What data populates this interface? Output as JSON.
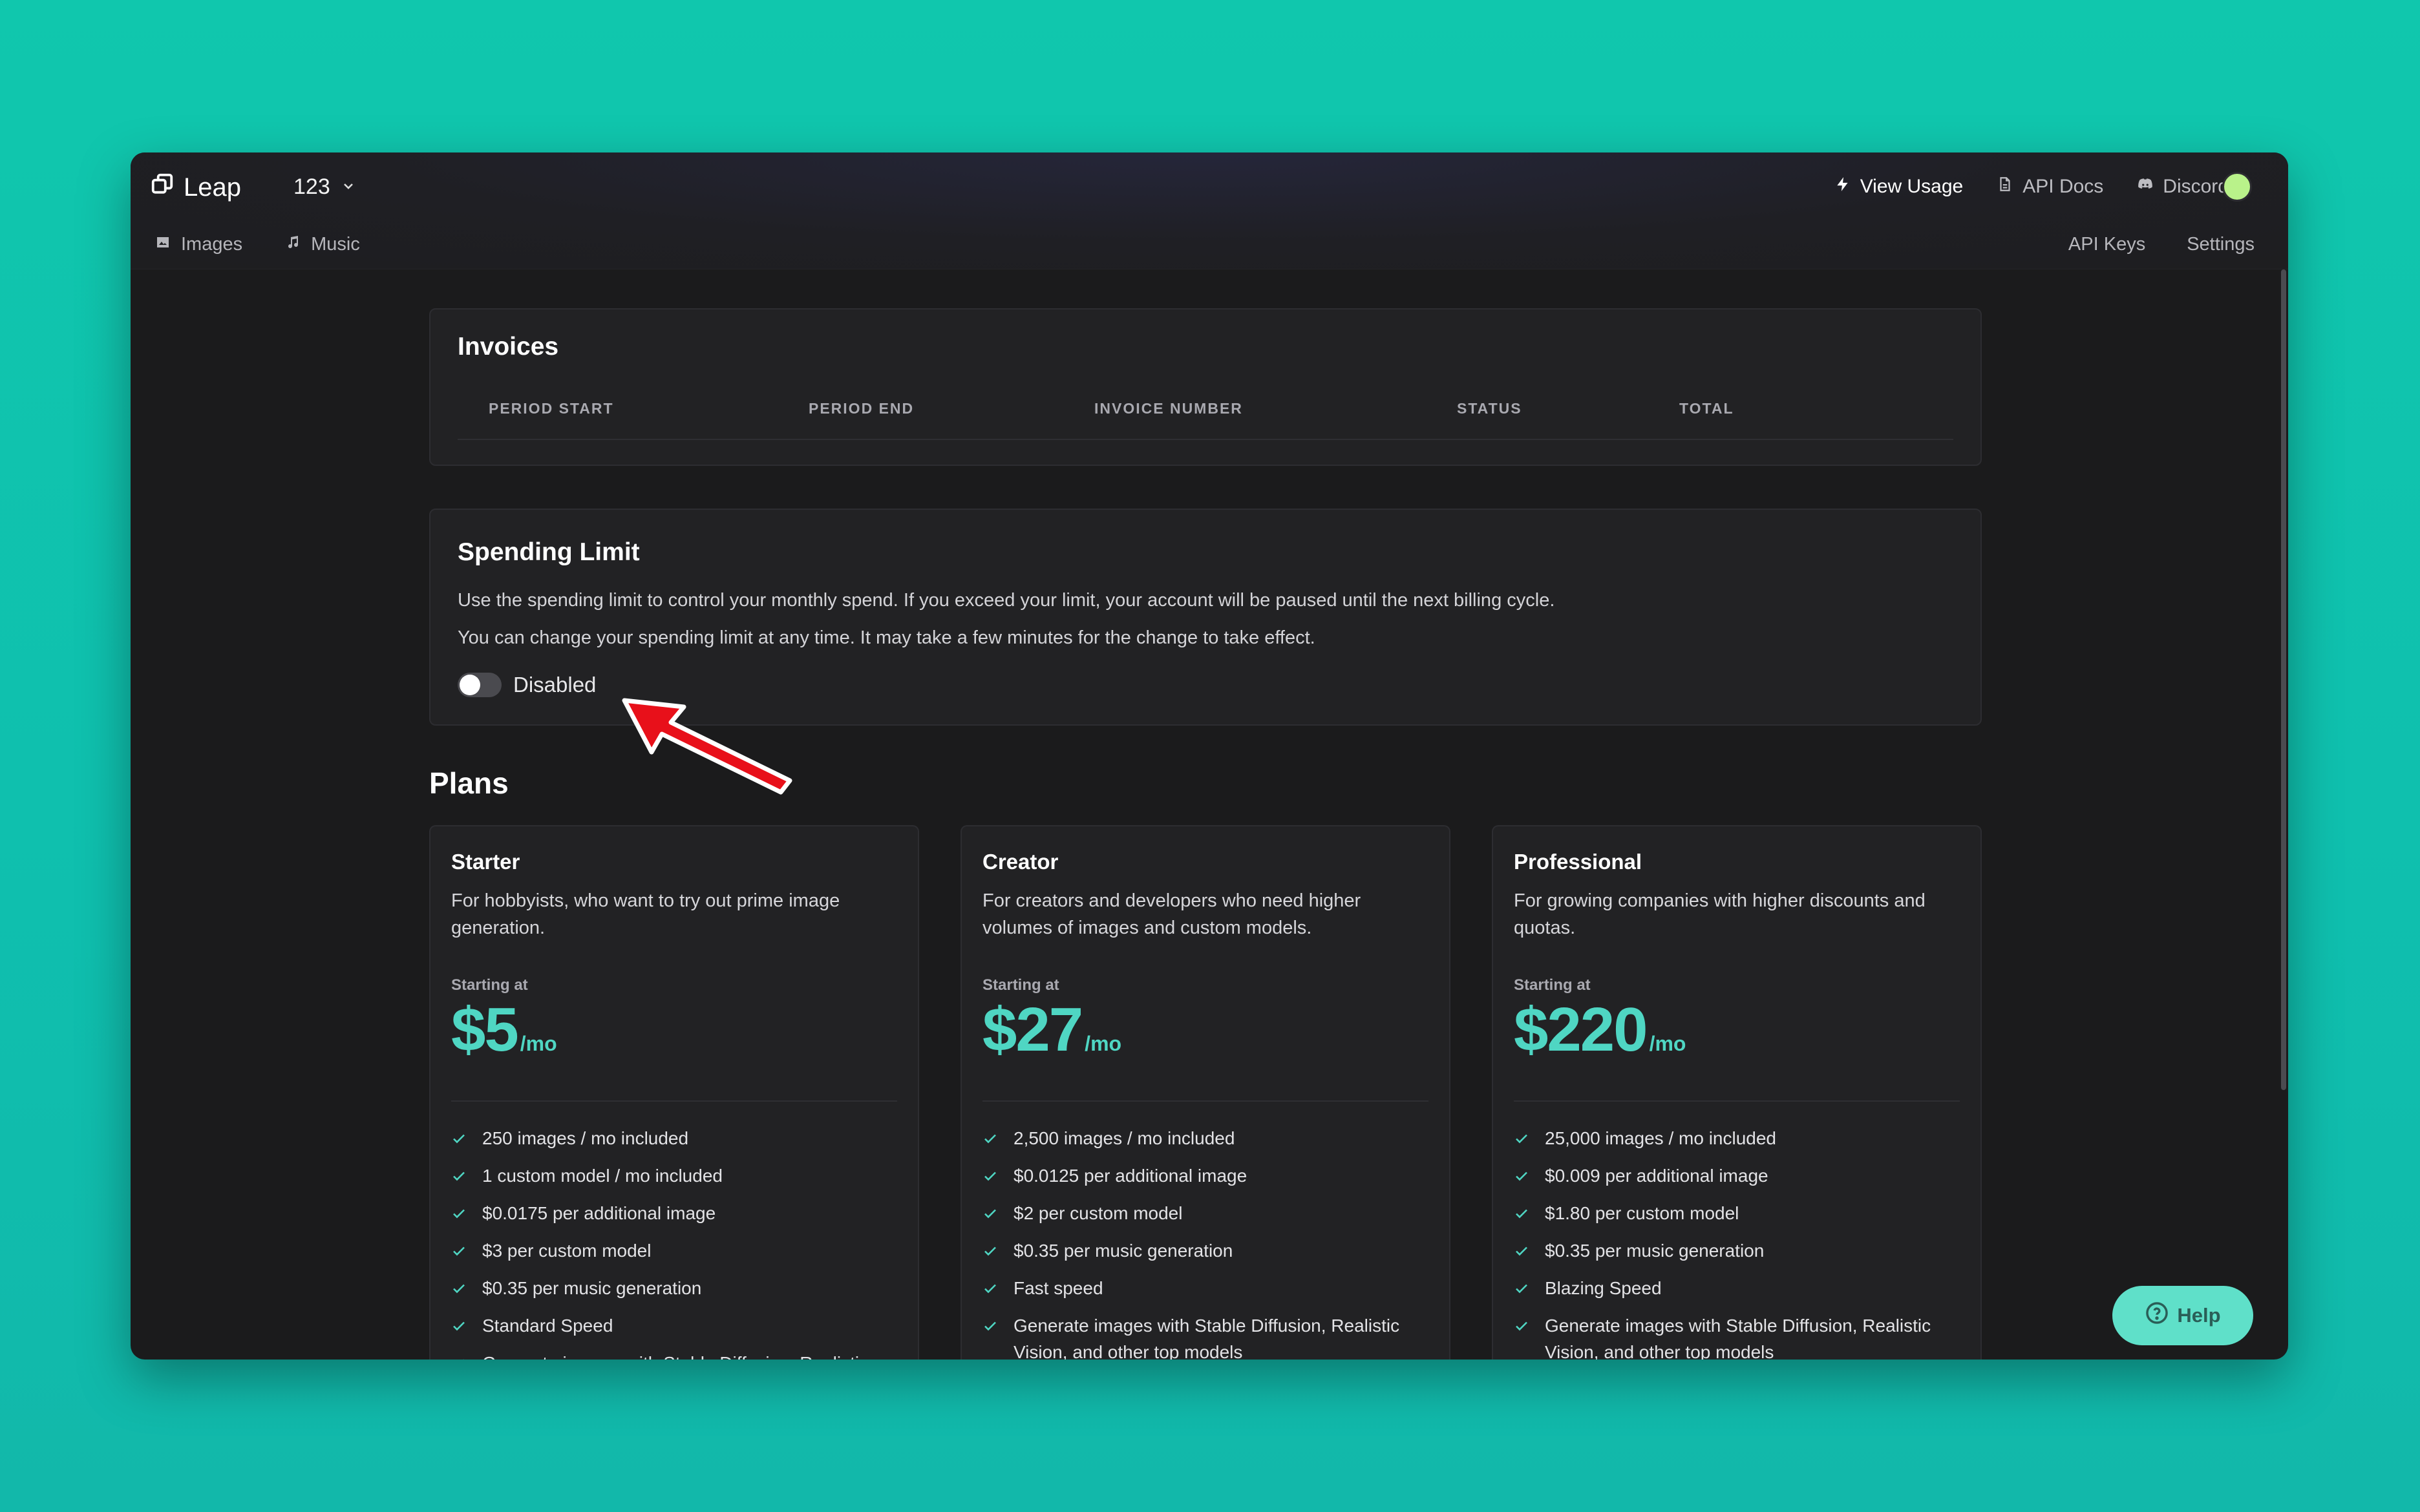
{
  "app": {
    "name": "Leap",
    "project": "123"
  },
  "header": {
    "view_usage": "View Usage",
    "api_docs": "API Docs",
    "discord": "Discord"
  },
  "subnav": {
    "images": "Images",
    "music": "Music",
    "api_keys": "API Keys",
    "settings": "Settings"
  },
  "invoices": {
    "title": "Invoices",
    "columns": [
      "PERIOD START",
      "PERIOD END",
      "INVOICE NUMBER",
      "STATUS",
      "TOTAL"
    ]
  },
  "spending": {
    "title": "Spending Limit",
    "line1": "Use the spending limit to control your monthly spend. If you exceed your limit, your account will be paused until the next billing cycle.",
    "line2": "You can change your spending limit at any time. It may take a few minutes for the change to take effect.",
    "toggle_label": "Disabled",
    "enabled": false
  },
  "plans": {
    "title": "Plans",
    "starting_label": "Starting at",
    "per": "/mo",
    "items": [
      {
        "name": "Starter",
        "desc": "For hobbyists, who want to try out prime image generation.",
        "price": "$5",
        "features": [
          "250 images / mo included",
          "1 custom model / mo included",
          "$0.0175 per additional image",
          "$3 per custom model",
          "$0.35 per music generation",
          "Standard Speed",
          "Generate images with Stable Diffusion, Realistic"
        ]
      },
      {
        "name": "Creator",
        "desc": "For creators and developers who need higher volumes of images and custom models.",
        "price": "$27",
        "features": [
          "2,500 images / mo included",
          "$0.0125 per additional image",
          "$2 per custom model",
          "$0.35 per music generation",
          "Fast speed",
          "Generate images with Stable Diffusion, Realistic Vision, and other top models"
        ]
      },
      {
        "name": "Professional",
        "desc": "For growing companies with higher discounts and quotas.",
        "price": "$220",
        "features": [
          "25,000 images / mo included",
          "$0.009 per additional image",
          "$1.80 per custom model",
          "$0.35 per music generation",
          "Blazing Speed",
          "Generate images with Stable Diffusion, Realistic Vision, and other top models"
        ]
      }
    ]
  },
  "help": {
    "label": "Help"
  },
  "colors": {
    "accent": "#4fd6c3",
    "help_bg": "#5fe0c9",
    "avatar": "#b9f28a",
    "annotation_arrow": "#e8101a"
  }
}
